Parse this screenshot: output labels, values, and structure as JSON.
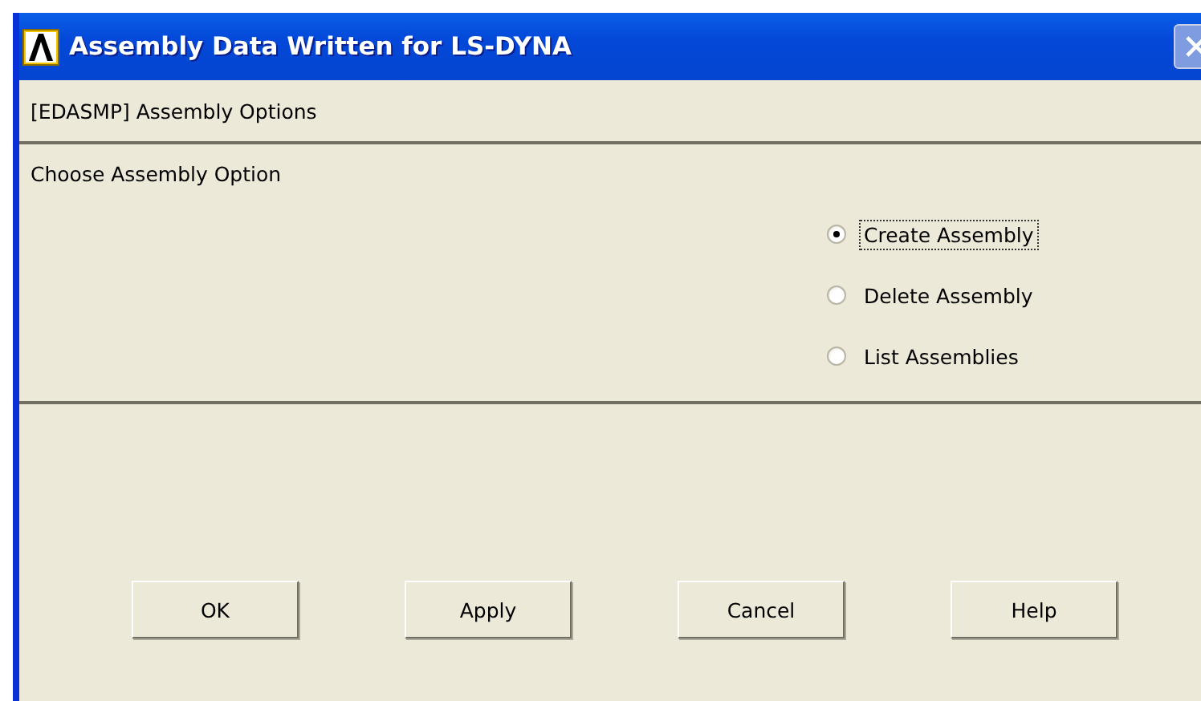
{
  "window": {
    "title": "Assembly Data Written for LS-DYNA"
  },
  "header": "[EDASMP] Assembly Options",
  "prompt": "Choose Assembly Option",
  "options": [
    {
      "label": "Create Assembly",
      "selected": true
    },
    {
      "label": "Delete Assembly",
      "selected": false
    },
    {
      "label": "List Assemblies",
      "selected": false
    }
  ],
  "buttons": [
    "OK",
    "Apply",
    "Cancel",
    "Help"
  ]
}
